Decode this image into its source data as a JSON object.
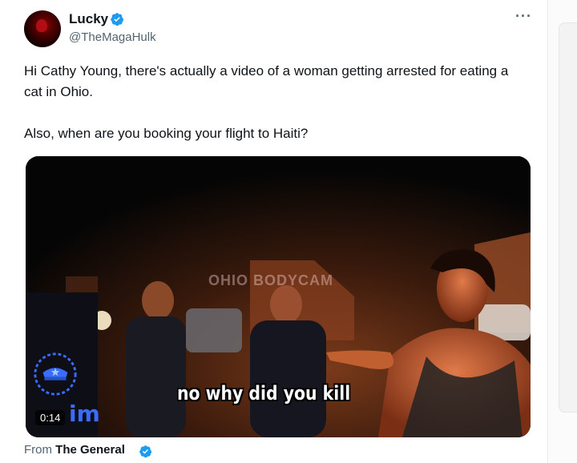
{
  "author": {
    "name": "Lucky",
    "handle": "@TheMagaHulk",
    "verified_icon": "verified-badge-icon"
  },
  "menu_icon_glyph": "···",
  "tweet": {
    "paragraph1": "Hi Cathy Young, there's actually a video of a woman getting arrested for eating a cat in Ohio.",
    "paragraph2": "Also, when are you booking your flight to Haiti?"
  },
  "media": {
    "watermark": "OHIO BODYCAM",
    "caption": "no why did you kill",
    "timer": "0:14",
    "corner_logo_text": "im"
  },
  "source": {
    "prefix": "From",
    "name": "The General"
  },
  "colors": {
    "verified_blue": "#1d9bf0",
    "text": "#0f1419",
    "muted": "#536471"
  }
}
